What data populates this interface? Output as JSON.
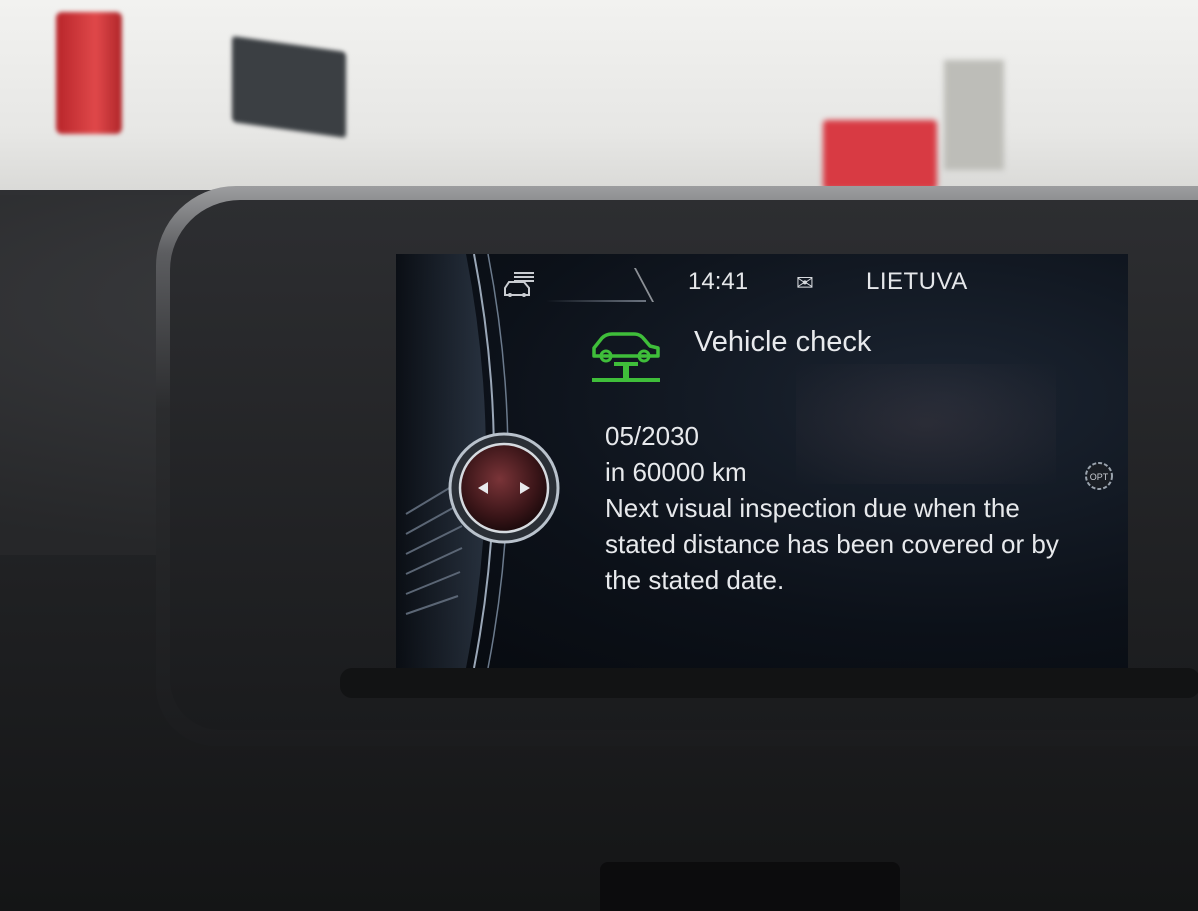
{
  "status_bar": {
    "time": "14:41",
    "region": "LIETUVA",
    "icons": [
      "car-menu-icon",
      "mail-icon"
    ]
  },
  "vehicle_check": {
    "title": "Vehicle check",
    "icon": "vehicle-lift-icon",
    "due_date": "05/2030",
    "due_distance": "in 60000 km",
    "description": "Next visual inspection due when the stated distance has been covered or by the stated date."
  },
  "side_controls": {
    "option_icon": "option-icon",
    "option_label": "OPT",
    "navigation_icon": "controller-arrows-icon"
  },
  "colors": {
    "accent_green": "#3fbe3a",
    "screen_bg": "#0c1119",
    "text": "#e7e9ec"
  }
}
